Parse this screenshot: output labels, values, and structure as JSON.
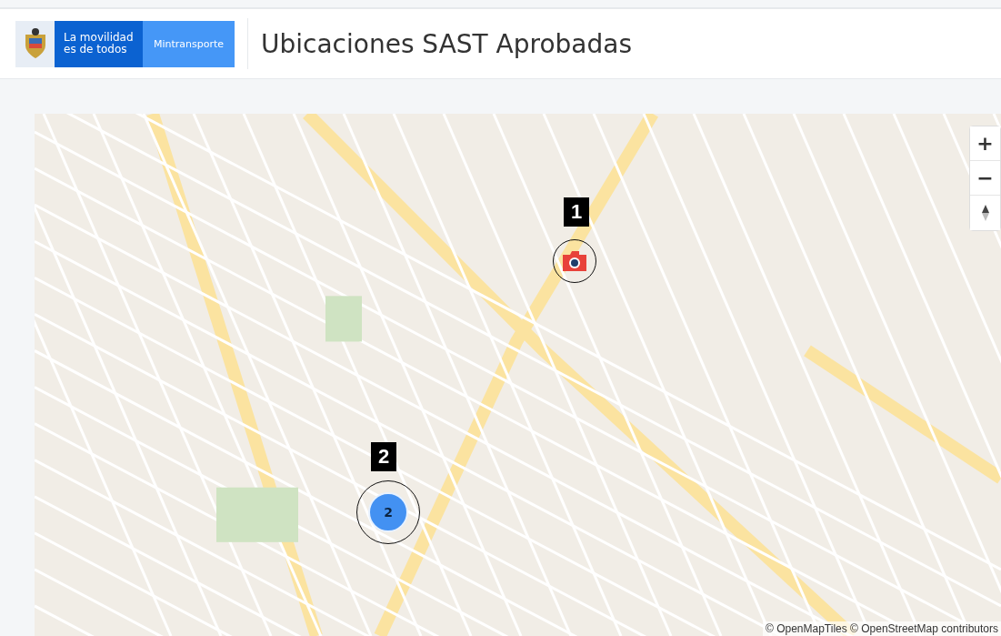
{
  "header": {
    "logo": {
      "slogan": "La movilidad es de todos",
      "ministry": "Mintransporte"
    },
    "title": "Ubicaciones SAST Aprobadas"
  },
  "map": {
    "controls": [
      "+",
      "−"
    ],
    "markers": [
      {
        "kind": "camera",
        "label": "1"
      },
      {
        "kind": "cluster",
        "label": "2",
        "count": "2"
      }
    ],
    "attribution": "© OpenMapTiles © OpenStreetMap contributors"
  }
}
